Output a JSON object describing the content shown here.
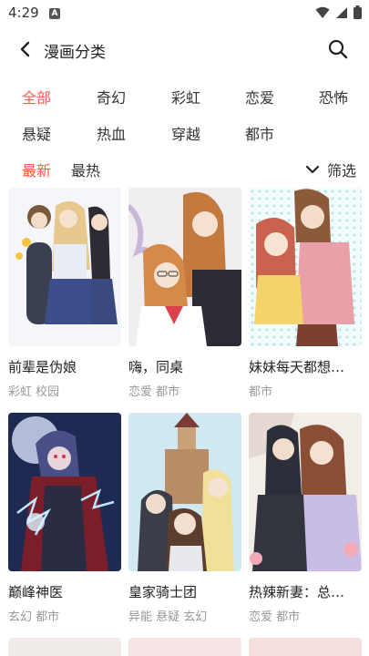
{
  "status": {
    "time": "4:29",
    "notif": "A"
  },
  "header": {
    "title": "漫画分类"
  },
  "categories": [
    "全部",
    "奇幻",
    "彩虹",
    "恋爱",
    "恐怖",
    "悬疑",
    "热血",
    "穿越",
    "都市"
  ],
  "sort": {
    "latest": "最新",
    "hottest": "最热",
    "filter": "筛选"
  },
  "comics": [
    {
      "title": "前辈是伪娘",
      "tags": "彩虹 校园"
    },
    {
      "title": "嗨，同桌",
      "tags": "恋爱 都市"
    },
    {
      "title": "妹妹每天都想…",
      "tags": "都市"
    },
    {
      "title": "巅峰神医",
      "tags": "玄幻 都市"
    },
    {
      "title": "皇家骑士团",
      "tags": "异能 悬疑 玄幻"
    },
    {
      "title": "热辣新妻：总…",
      "tags": "恋爱 都市"
    }
  ],
  "colors": {
    "accent": "#ff5b4d",
    "text": "#222222",
    "muted": "#999999"
  }
}
